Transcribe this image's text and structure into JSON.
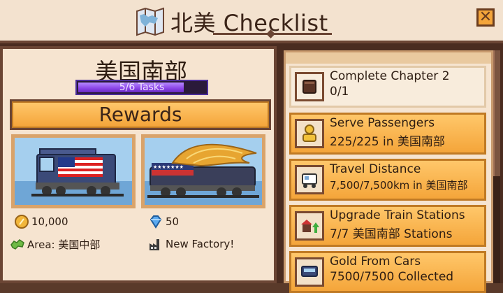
{
  "header": {
    "title": "北美 Checklist",
    "close_icon": "close-icon"
  },
  "region": {
    "name": "美国南部",
    "progress_text": "5/6 Tasks",
    "progress_fraction": 0.833
  },
  "rewards": {
    "header": "Rewards",
    "cards": [
      {
        "name": "train-reward-1",
        "icon": "locomotive-flag-icon"
      },
      {
        "name": "train-reward-2",
        "icon": "golden-eagle-locomotive-icon"
      }
    ],
    "gold": "10,000",
    "gems": "50",
    "area_label": "Area: 美国中部",
    "factory_label": "New Factory!"
  },
  "checklist": [
    {
      "title": "Complete Chapter 2",
      "detail": "0/1",
      "icon": "book-icon",
      "completed": false
    },
    {
      "title": "Serve Passengers",
      "detail": "225/225 in 美国南部",
      "icon": "passenger-icon",
      "completed": true
    },
    {
      "title": "Travel Distance",
      "detail": "7,500/7,500km in 美国南部",
      "icon": "train-distance-icon",
      "completed": true
    },
    {
      "title": "Upgrade Train Stations",
      "detail": "7/7 美国南部 Stations",
      "icon": "station-upgrade-icon",
      "completed": true
    },
    {
      "title": "Gold From Cars",
      "detail": "7500/7500 Collected",
      "icon": "gold-car-icon",
      "completed": true
    }
  ],
  "colors": {
    "accent_orange": "#f4a53a",
    "panel_bg": "#f6e4d0",
    "frame_brown": "#6b4534",
    "progress_purple": "#8a44e6"
  }
}
